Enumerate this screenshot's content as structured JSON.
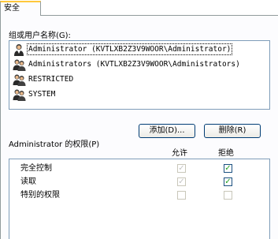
{
  "tabs": [
    {
      "label": "安全"
    }
  ],
  "groups": {
    "label": "组或用户名称(G):",
    "items": [
      {
        "name": "Administrator (KVTLXB2Z3V9WOOR\\Administrator)",
        "icon": "user-icon",
        "selected": true
      },
      {
        "name": "Administrators (KVTLXB2Z3V9WOOR\\Administrators)",
        "icon": "group-icon",
        "selected": false
      },
      {
        "name": "RESTRICTED",
        "icon": "group-icon",
        "selected": false
      },
      {
        "name": "SYSTEM",
        "icon": "group-icon",
        "selected": false
      }
    ]
  },
  "buttons": {
    "add": "添加(D)...",
    "remove": "删除(R)"
  },
  "permissions": {
    "label": "Administrator 的权限(P)",
    "allow_header": "允许",
    "deny_header": "拒绝",
    "rows": [
      {
        "name": "完全控制",
        "allow": true,
        "allow_enabled": false,
        "deny": true,
        "deny_enabled": true
      },
      {
        "name": "读取",
        "allow": true,
        "allow_enabled": false,
        "deny": true,
        "deny_enabled": true
      },
      {
        "name": "特别的权限",
        "allow": false,
        "allow_enabled": false,
        "deny": false,
        "deny_enabled": false
      }
    ]
  },
  "colors": {
    "tab_highlight": "#ffc83c",
    "list_border": "#7f9db9",
    "check_green": "#21a121",
    "button_border": "#003c74"
  }
}
